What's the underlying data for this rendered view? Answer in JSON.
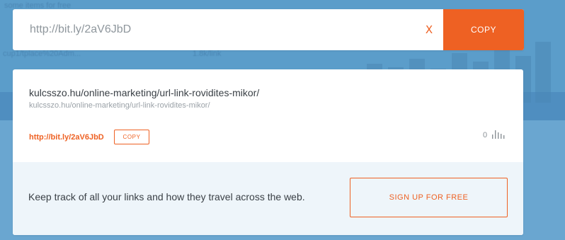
{
  "background": {
    "text_fragments": [
      "some items for free",
      "cup1/tplace%20Adm...",
      "1.8k/link"
    ]
  },
  "shorten_bar": {
    "input_value": "http://bit.ly/2aV6JbD",
    "clear_label": "X",
    "copy_label": "COPY"
  },
  "result": {
    "title": "kulcsszo.hu/online-marketing/url-link-rovidites-mikor/",
    "long_url": "kulcsszo.hu/online-marketing/url-link-rovidites-mikor/",
    "short_link": "http://bit.ly/2aV6JbD",
    "copy_label": "COPY",
    "click_count": "0",
    "stats_icon": "bar-chart-icon"
  },
  "signup": {
    "text": "Keep track of all your links and how they travel across the web.",
    "button_label": "SIGN UP FOR FREE"
  },
  "colors": {
    "accent": "#ee6123",
    "background": "#5d9cc6",
    "panel": "#eef5fa"
  }
}
